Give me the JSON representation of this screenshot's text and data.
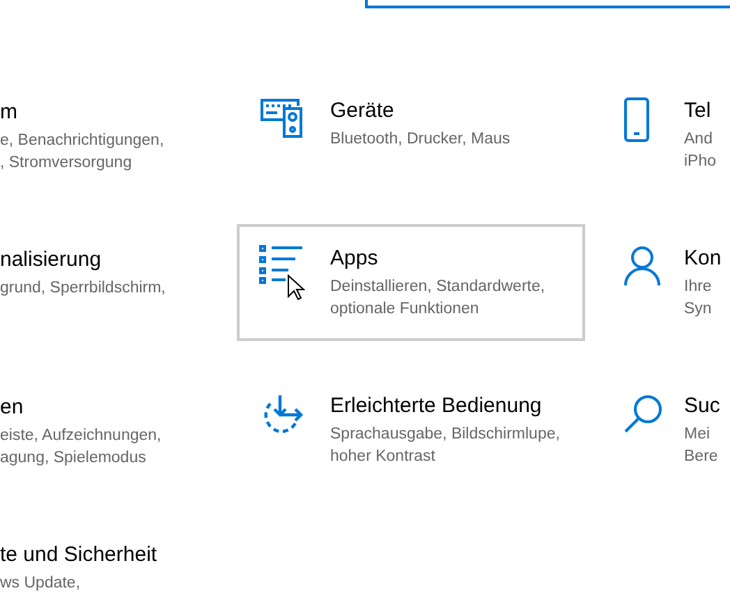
{
  "search_box": {
    "focused": true
  },
  "rows": [
    [
      {
        "kind": "none",
        "title": "m",
        "description": [
          "e, Benachrichtigungen,",
          ", Stromversorgung"
        ]
      },
      {
        "kind": "devices",
        "title": "Geräte",
        "description": [
          "Bluetooth, Drucker, Maus"
        ],
        "hovered": false
      },
      {
        "kind": "phone",
        "title": "Tel",
        "description": [
          "And",
          "iPho"
        ],
        "hovered": false
      }
    ],
    [
      {
        "kind": "none",
        "title": "nalisierung",
        "description": [
          "grund, Sperrbildschirm,"
        ]
      },
      {
        "kind": "apps",
        "title": "Apps",
        "description": [
          "Deinstallieren, Standardwerte,",
          "optionale Funktionen"
        ],
        "hovered": true
      },
      {
        "kind": "person",
        "title": "Kon",
        "description": [
          "Ihre",
          "Syn"
        ],
        "hovered": false
      }
    ],
    [
      {
        "kind": "none",
        "title": "en",
        "description": [
          "eiste, Aufzeichnungen,",
          "agung, Spielemodus"
        ]
      },
      {
        "kind": "accessibility",
        "title": "Erleichterte Bedienung",
        "description": [
          "Sprachausgabe, Bildschirmlupe,",
          "hoher Kontrast"
        ],
        "hovered": false
      },
      {
        "kind": "search",
        "title": "Suc",
        "description": [
          "Mei",
          "Bere"
        ],
        "hovered": false
      }
    ],
    [
      {
        "kind": "none",
        "title": "te und Sicherheit",
        "description": [
          "ws Update,"
        ]
      }
    ]
  ]
}
